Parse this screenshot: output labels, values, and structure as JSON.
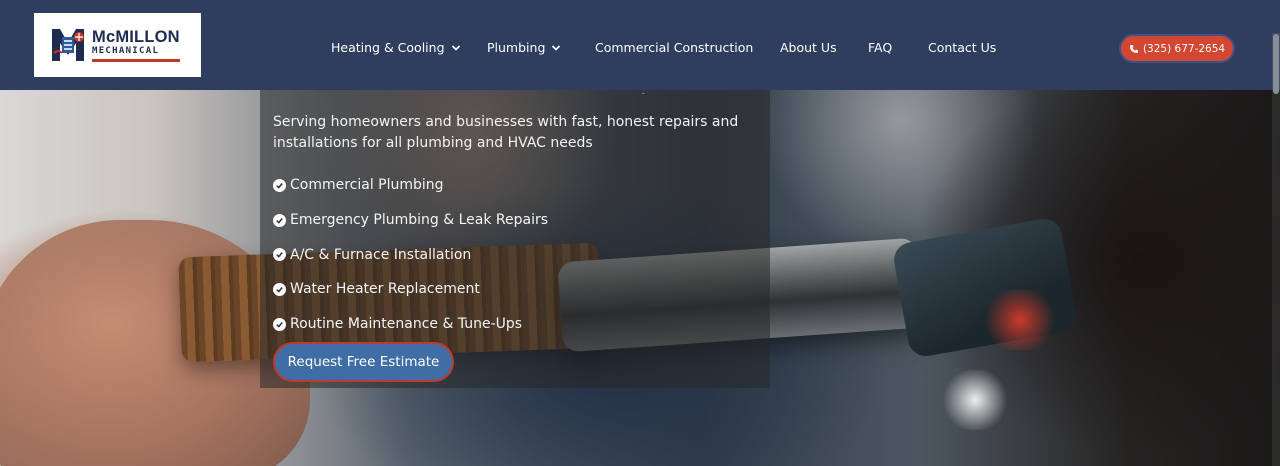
{
  "brand": {
    "name": "McMILLON",
    "subtitle": "MECHANICAL",
    "logo_colors": {
      "navy": "#1f2c4f",
      "red": "#c0392b",
      "blue": "#2e5a9c"
    }
  },
  "nav": {
    "items": [
      {
        "label": "Heating & Cooling",
        "has_dropdown": true
      },
      {
        "label": "Plumbing",
        "has_dropdown": true
      },
      {
        "label": "Commercial Construction",
        "has_dropdown": false
      },
      {
        "label": "About Us",
        "has_dropdown": false
      },
      {
        "label": "FAQ",
        "has_dropdown": false
      },
      {
        "label": "Contact Us",
        "has_dropdown": false
      }
    ],
    "phone": "(325) 677-2654"
  },
  "hero": {
    "heading_fragment": ",",
    "intro": "Serving homeowners and businesses with fast, honest repairs and installations for all plumbing and HVAC needs",
    "services": [
      "Commercial Plumbing",
      "Emergency Plumbing & Leak Repairs",
      "A/C & Furnace Installation",
      "Water Heater Replacement",
      "Routine Maintenance & Tune-Ups"
    ],
    "cta_label": "Request Free Estimate"
  },
  "colors": {
    "header_bg": "#2f3e5e",
    "cta_bg": "#3f6da6",
    "cta_border": "#c0392b",
    "phone_bg": "#d24632"
  }
}
